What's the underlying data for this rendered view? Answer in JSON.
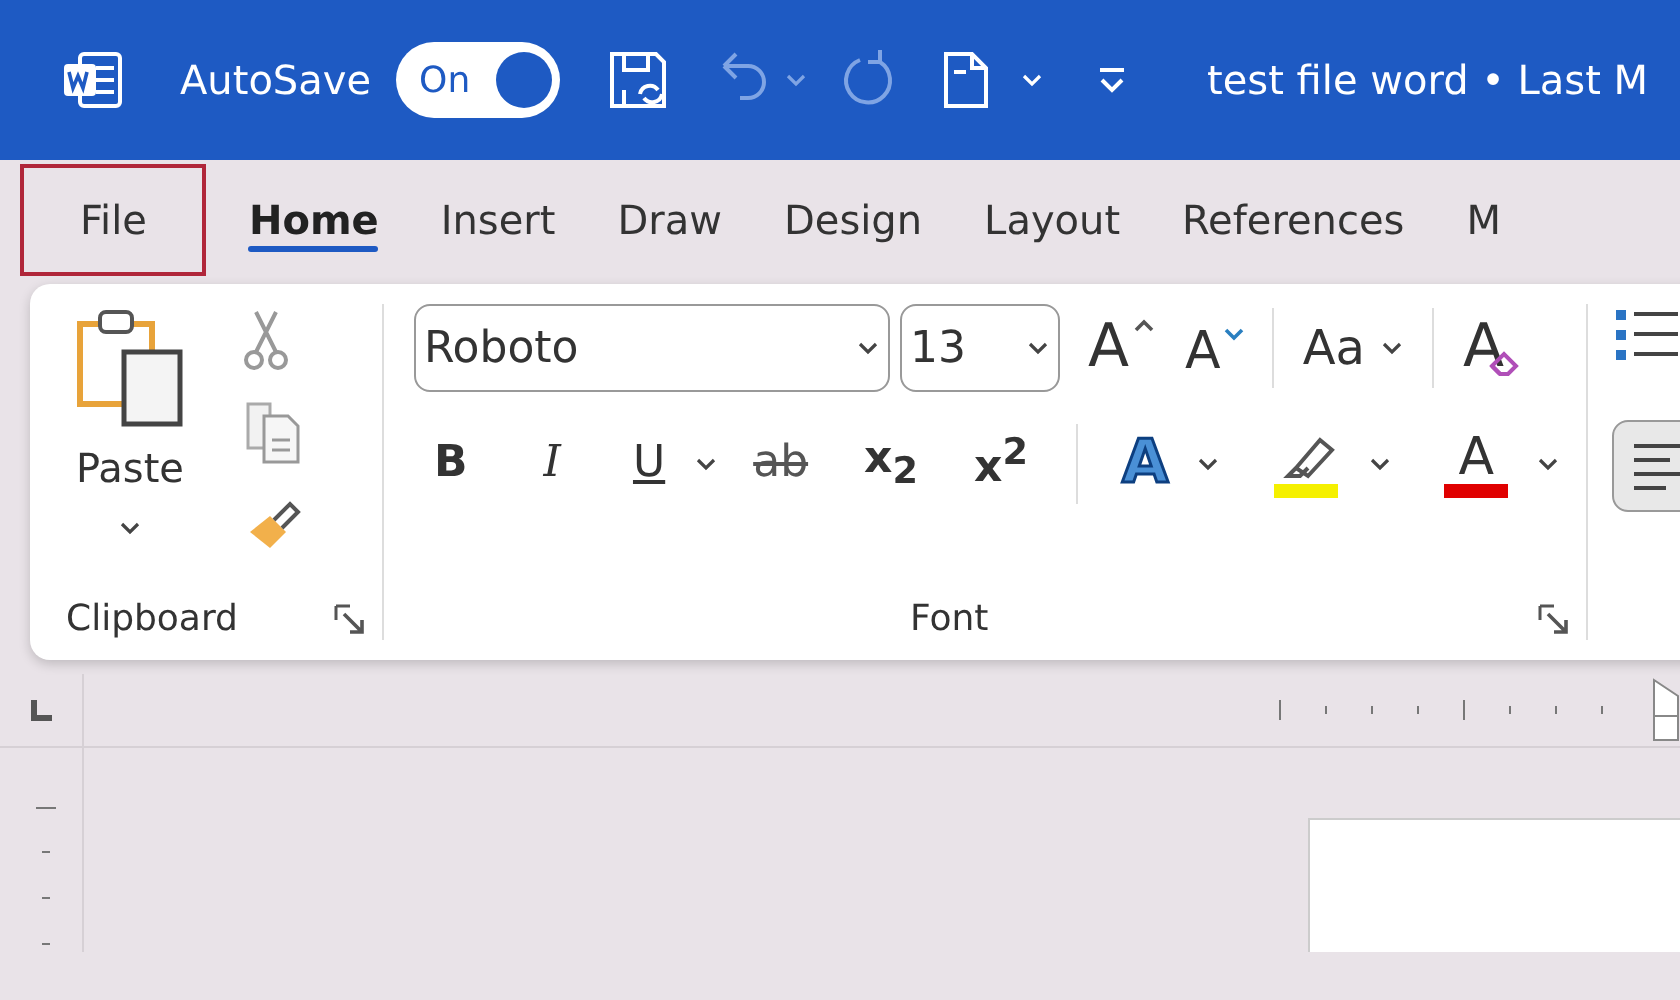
{
  "title_bar": {
    "autosave_label": "AutoSave",
    "autosave": {
      "label": "On",
      "on": true
    },
    "title": "test file word • Last M"
  },
  "tabs": [
    {
      "label": "File",
      "selected": false,
      "outlined": true
    },
    {
      "label": "Home",
      "selected": true,
      "outlined": false
    },
    {
      "label": "Insert",
      "selected": false,
      "outlined": false
    },
    {
      "label": "Draw",
      "selected": false,
      "outlined": false
    },
    {
      "label": "Design",
      "selected": false,
      "outlined": false
    },
    {
      "label": "Layout",
      "selected": false,
      "outlined": false
    },
    {
      "label": "References",
      "selected": false,
      "outlined": false
    },
    {
      "label": "M",
      "selected": false,
      "outlined": false
    }
  ],
  "ribbon": {
    "clipboard": {
      "paste_label": "Paste",
      "group_label": "Clipboard"
    },
    "font": {
      "font_name": "Roboto",
      "font_size": "13",
      "group_label": "Font",
      "row_1": [
        {
          "kind": "grow",
          "label": "A"
        },
        {
          "kind": "shrink",
          "label": "A"
        },
        {
          "kind": "case",
          "label": "Aa"
        },
        {
          "kind": "clear",
          "label": "A"
        }
      ],
      "row_2": [
        {
          "kind": "bold",
          "label": "B"
        },
        {
          "kind": "italic",
          "label": "I"
        },
        {
          "kind": "underline",
          "label": "U"
        },
        {
          "kind": "strike",
          "label": "ab"
        },
        {
          "kind": "script",
          "label": "x$_{2}$"
        },
        {
          "kind": "script",
          "label": "x$^{2}$"
        },
        {
          "kind": "effects",
          "label": "A"
        },
        {
          "kind": "highlight",
          "color": "#f5f000"
        },
        {
          "kind": "fontcolor",
          "label": "A",
          "color": "#e00000"
        }
      ]
    },
    "paragraph": {
      "align_left": {
        "selected": true
      }
    }
  }
}
